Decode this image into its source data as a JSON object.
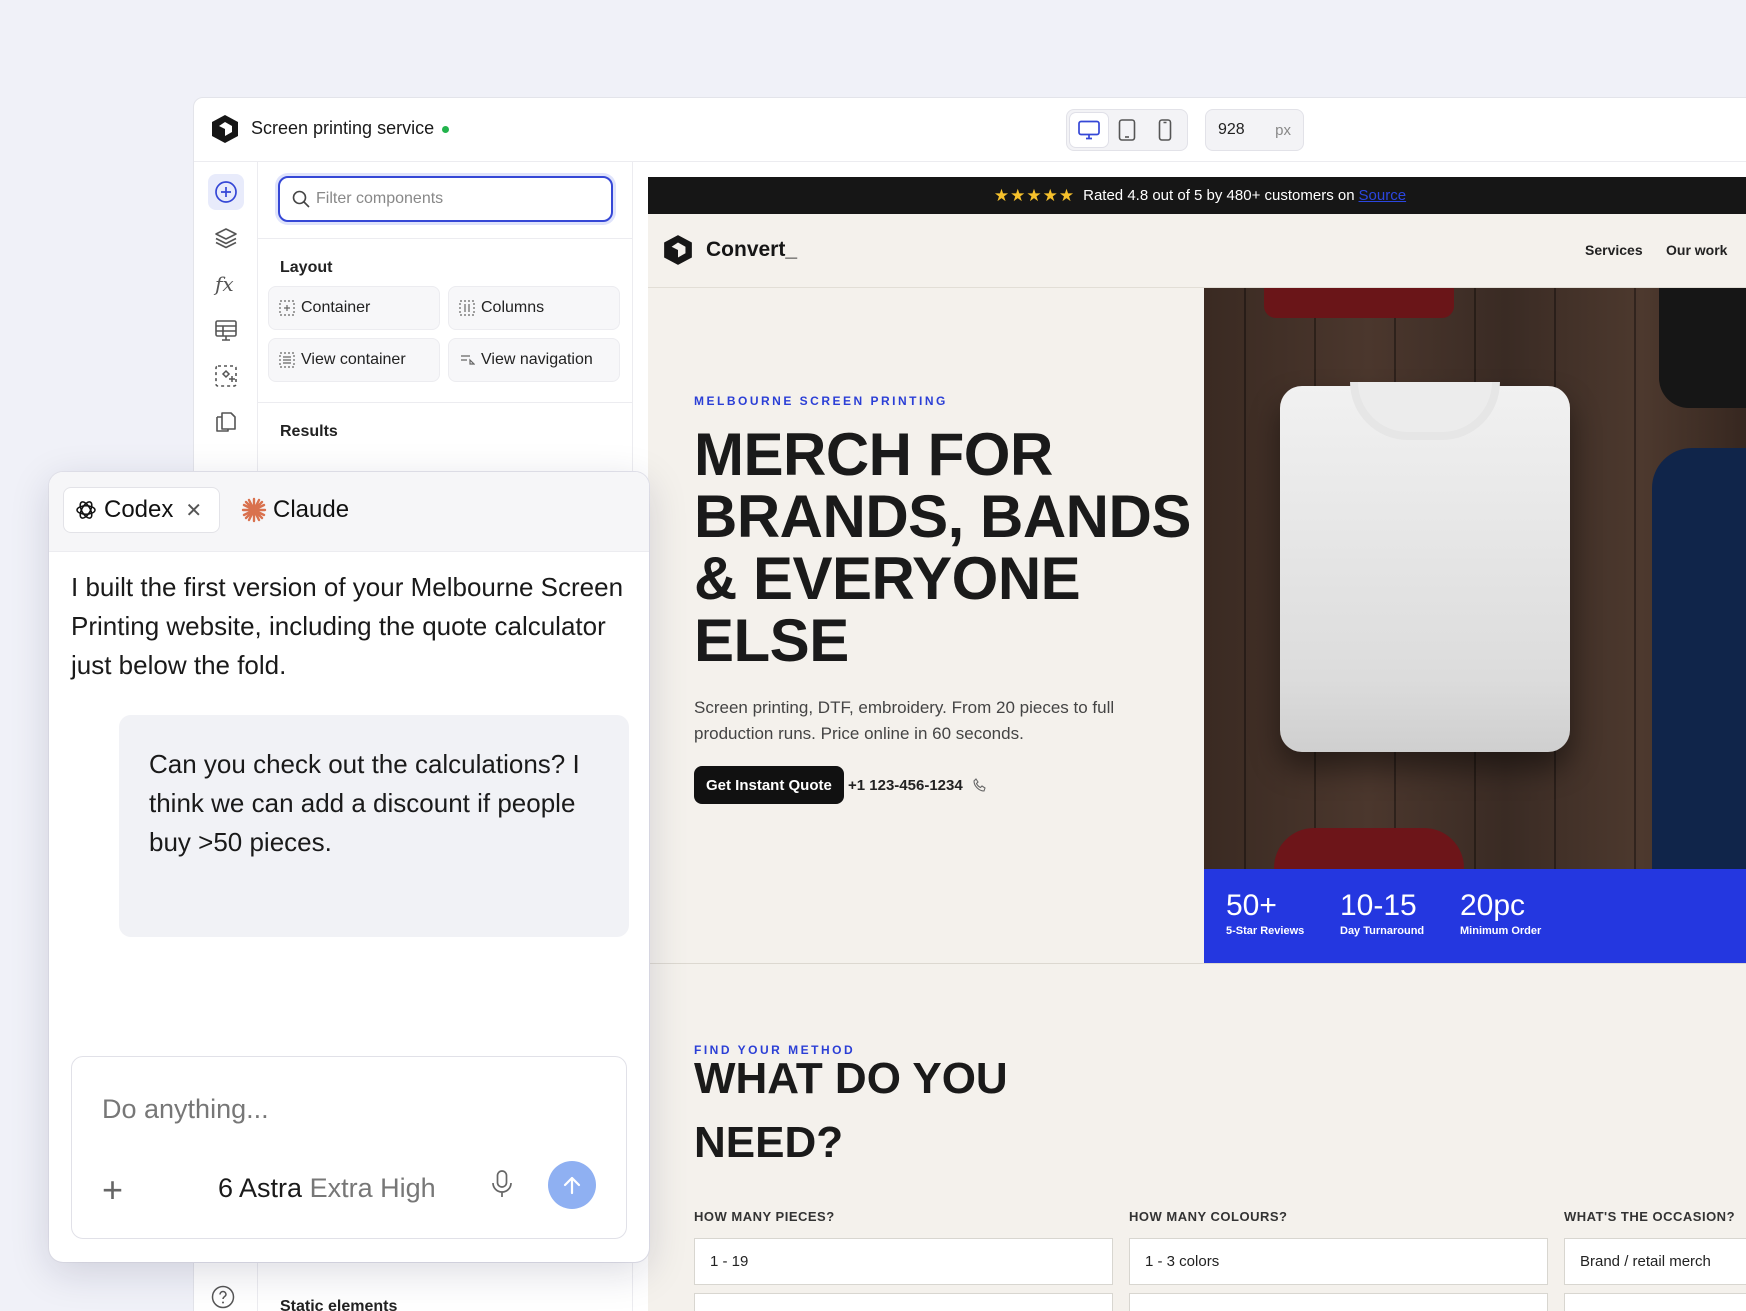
{
  "project": {
    "title": "Screen printing service",
    "status_color": "#22b34c"
  },
  "toolbar": {
    "devices": [
      {
        "name": "desktop",
        "icon": "monitor-icon",
        "active": true
      },
      {
        "name": "tablet",
        "icon": "tablet-icon",
        "active": false
      },
      {
        "name": "mobile",
        "icon": "phone-icon",
        "active": false
      }
    ],
    "width_value": "928",
    "width_unit": "px"
  },
  "rail": {
    "icons": [
      "add-icon",
      "layers-icon",
      "function-icon",
      "table-icon",
      "component-select-icon",
      "pages-icon",
      "help-icon"
    ]
  },
  "panel": {
    "filter_placeholder": "Filter components",
    "layout_title": "Layout",
    "layout_items": [
      "Container",
      "Columns",
      "View container",
      "View navigation"
    ],
    "results_title": "Results",
    "static_title": "Static elements"
  },
  "preview": {
    "banner": {
      "stars": "★★★★★",
      "text": "Rated 4.8 out of 5 by 480+ customers on",
      "link": "Source"
    },
    "nav": {
      "brand": "Convert_",
      "links": [
        "Services",
        "Our work"
      ]
    },
    "hero": {
      "eyebrow": "MELBOURNE SCREEN PRINTING",
      "headline": "MERCH FOR BRANDS, BANDS & EVERYONE ELSE",
      "subtitle": "Screen printing, DTF, embroidery. From 20 pieces to full production runs. Price online in 60 seconds.",
      "cta": "Get Instant Quote",
      "phone": "+1 123-456-1234"
    },
    "stats": [
      {
        "value": "50+",
        "label": "5-Star Reviews"
      },
      {
        "value": "10-15",
        "label": "Day Turnaround"
      },
      {
        "value": "20pc",
        "label": "Minimum Order"
      }
    ],
    "method": {
      "eyebrow": "FIND YOUR METHOD",
      "heading": "WHAT DO YOU NEED?",
      "fields": [
        {
          "label": "HOW MANY PIECES?",
          "value": "1 - 19"
        },
        {
          "label": "HOW MANY COLOURS?",
          "value": "1 - 3 colors"
        },
        {
          "label": "WHAT'S THE OCCASION?",
          "value": "Brand / retail merch"
        }
      ]
    },
    "colors": {
      "accent": "#2437e0",
      "dark": "#161616",
      "background": "#f4f1ec"
    }
  },
  "chat": {
    "tabs": [
      {
        "label": "Codex",
        "icon": "openai-icon",
        "active": true
      },
      {
        "label": "Claude",
        "icon": "claude-icon",
        "active": false
      }
    ],
    "agent_message": "I built the first version of your Melbourne Screen Printing website, including the quote calculator just below the fold.",
    "user_message": "Can you check out the calculations? I think we can add a discount if people buy >50 pieces.",
    "composer": {
      "placeholder": "Do anything...",
      "model": "6 Astra",
      "level": "Extra High",
      "send_color": "#8fb0f2"
    }
  }
}
